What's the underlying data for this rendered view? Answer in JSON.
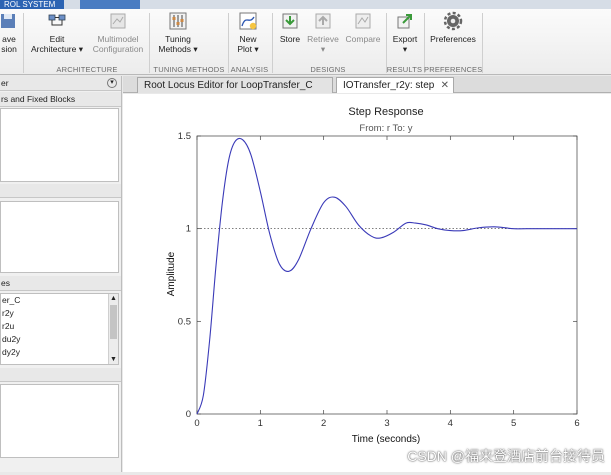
{
  "window": {
    "tab_label": "ROL SYSTEM"
  },
  "ribbon": {
    "buttons": {
      "save": "ave\nsion",
      "edit_architecture": "Edit\nArchitecture ▾",
      "multimodel": "Multimodel\nConfiguration",
      "tuning": "Tuning\nMethods ▾",
      "new_plot": "New\nPlot ▾",
      "store": "Store",
      "retrieve": "Retrieve\n▾",
      "compare": "Compare",
      "export": "Export\n▾",
      "preferences": "Preferences"
    },
    "groups": {
      "architecture": "ARCHITECTURE",
      "tuning": "TUNING METHODS",
      "analysis": "ANALYSIS",
      "designs": "DESIGNS",
      "results": "RESULTS",
      "preferences": "PREFERENCES"
    }
  },
  "left_panel": {
    "header1": "er",
    "blocks_header": "rs and Fixed Blocks",
    "responses_header": "es",
    "responses": [
      "er_C",
      "r2y",
      "r2u",
      "du2y",
      "dy2y"
    ]
  },
  "doc_tabs": [
    {
      "label": "Root Locus Editor for LoopTransfer_C"
    },
    {
      "label": "IOTransfer_r2y: step"
    }
  ],
  "figure": {
    "title": "Step Response",
    "subtitle": "From: r  To: y",
    "xlabel": "Time (seconds)",
    "ylabel": "Amplitude"
  },
  "chart_data": {
    "type": "line",
    "title": "Step Response",
    "subtitle": "From: r  To: y",
    "xlabel": "Time (seconds)",
    "ylabel": "Amplitude",
    "xlim": [
      0,
      6
    ],
    "ylim": [
      0,
      1.5
    ],
    "xticks": [
      "0",
      "1",
      "2",
      "3",
      "4",
      "5",
      "6"
    ],
    "yticks": [
      "0",
      "0.5",
      "1",
      "1.5"
    ],
    "reference_line": 1,
    "series": [
      {
        "color": "#3a3ab8",
        "x": [
          0,
          0.1,
          0.2,
          0.3,
          0.4,
          0.5,
          0.6,
          0.72,
          0.85,
          1.0,
          1.15,
          1.3,
          1.45,
          1.6,
          1.8,
          2.0,
          2.17,
          2.35,
          2.55,
          2.75,
          2.9,
          3.1,
          3.3,
          3.45,
          3.62,
          3.8,
          4.0,
          4.2,
          4.45,
          4.7,
          5.0,
          5.3,
          5.6,
          6.0
        ],
        "y": [
          0,
          0.1,
          0.4,
          0.8,
          1.14,
          1.37,
          1.47,
          1.48,
          1.4,
          1.2,
          0.97,
          0.81,
          0.77,
          0.83,
          1.0,
          1.14,
          1.17,
          1.12,
          1.02,
          0.96,
          0.95,
          0.98,
          1.03,
          1.03,
          1.02,
          1.0,
          0.99,
          0.99,
          1.005,
          1.01,
          1.0,
          1.0,
          1.0,
          1.0
        ]
      }
    ]
  },
  "watermark": "CSDN @福来登酒店前台接待员"
}
